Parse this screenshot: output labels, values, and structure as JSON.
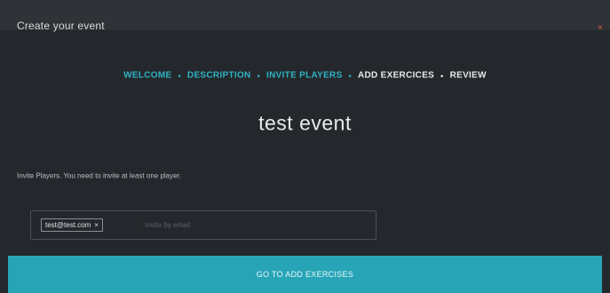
{
  "modal": {
    "title": "Create your event",
    "close_glyph": "×"
  },
  "steps": [
    {
      "label": "WELCOME",
      "state": "done"
    },
    {
      "label": "DESCRIPTION",
      "state": "done"
    },
    {
      "label": "INVITE PLAYERS",
      "state": "done"
    },
    {
      "label": "ADD EXERCICES",
      "state": "upcoming"
    },
    {
      "label": "REVIEW",
      "state": "upcoming"
    }
  ],
  "step_separator": "•",
  "event": {
    "name": "test event"
  },
  "invite": {
    "instructions": "Invite Players. You need to invite at least one player.",
    "tags": [
      {
        "email": "test@test.com",
        "remove_glyph": "×"
      }
    ],
    "input_placeholder": "Invite by email",
    "input_value": ""
  },
  "footer": {
    "button_label": "GO TO ADD EXERCISES"
  },
  "colors": {
    "accent": "#27a5b7",
    "step_done": "#2fb3c5",
    "close": "#e0533d",
    "background": "#24282c"
  },
  "icons": {
    "close": "close-icon",
    "tag_remove": "close-icon"
  }
}
